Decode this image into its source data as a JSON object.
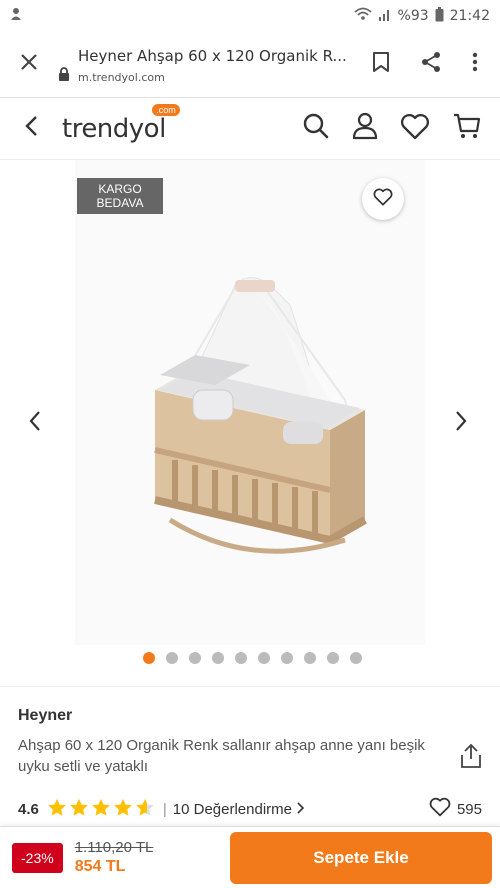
{
  "status_bar": {
    "battery_percent": "%93",
    "time": "21:42",
    "icons": [
      "notification-icon",
      "wifi-icon",
      "signal-icon",
      "battery-icon"
    ]
  },
  "browser": {
    "page_title": "Heyner Ahşap 60 x 120 Organik R...",
    "domain": "m.trendyol.com",
    "icons": [
      "close-icon",
      "lock-icon",
      "bookmark-icon",
      "share-icon",
      "more-icon"
    ]
  },
  "header": {
    "logo_text": "trendyol",
    "logo_badge": ".com",
    "icons": [
      "back-icon",
      "search-icon",
      "account-icon",
      "favorites-icon",
      "cart-icon"
    ]
  },
  "gallery": {
    "badge_line1": "KARGO",
    "badge_line2": "BEDAVA",
    "image_count": 10,
    "active_index": 0,
    "image_alt": "wooden baby crib with white canopy and grey bedding"
  },
  "product": {
    "brand": "Heyner",
    "title": "Ahşap 60 x 120 Organik Renk sallanır ahşap anne yanı beşik uyku setli ve yataklı",
    "rating": "4.6",
    "rating_value": 4.6,
    "review_count": "10",
    "review_label": "Değerlendirme",
    "favorite_count": "595"
  },
  "bottom_bar": {
    "discount": "-23%",
    "old_price": "1.110,20 TL",
    "new_price": "854 TL",
    "add_to_cart_label": "Sepete Ekle"
  },
  "colors": {
    "brand_orange": "#f27a1a",
    "discount_red": "#d0011b",
    "star_color": "#ffc000"
  }
}
